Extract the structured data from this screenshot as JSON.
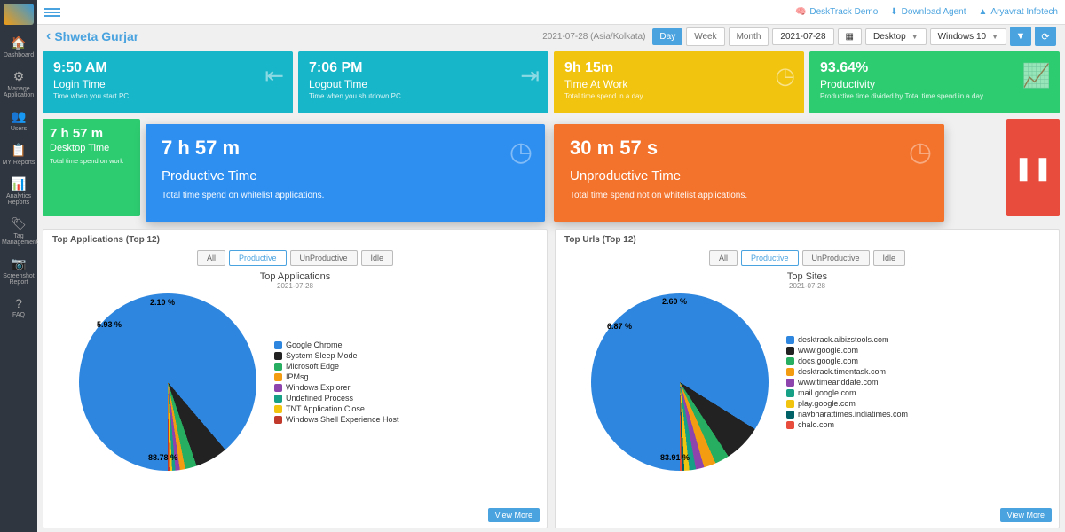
{
  "sidebar": {
    "items": [
      {
        "icon": "🏠",
        "label": "Dashboard"
      },
      {
        "icon": "⚙",
        "label": "Manage Application"
      },
      {
        "icon": "👥",
        "label": "Users"
      },
      {
        "icon": "📋",
        "label": "MY Reports"
      },
      {
        "icon": "📊",
        "label": "Analytics Reports"
      },
      {
        "icon": "🏷",
        "label": "Tag Management"
      },
      {
        "icon": "📷",
        "label": "Screenshot Report"
      },
      {
        "icon": "?",
        "label": "FAQ"
      }
    ]
  },
  "topbar": {
    "demo": "DeskTrack Demo",
    "download": "Download Agent",
    "company": "Aryavrat Infotech"
  },
  "breadcrumb": {
    "name": "Shweta Gurjar"
  },
  "toolbar": {
    "tz": "2021-07-28 (Asia/Kolkata)",
    "view_day": "Day",
    "view_week": "Week",
    "view_month": "Month",
    "date": "2021-07-28",
    "device": "Desktop",
    "os": "Windows 10"
  },
  "cards": {
    "login": {
      "value": "9:50 AM",
      "title": "Login Time",
      "sub": "Time when you start PC"
    },
    "logout": {
      "value": "7:06 PM",
      "title": "Logout Time",
      "sub": "Time when you shutdown PC"
    },
    "timeatwork": {
      "value": "9h 15m",
      "title": "Time At Work",
      "sub": "Total time spend in a day"
    },
    "productivity": {
      "value": "93.64%",
      "title": "Productivity",
      "sub": "Productive time divided by Total time spend in a day"
    },
    "desktop": {
      "value": "7 h 57 m",
      "title": "Desktop Time",
      "sub": "Total time spend on work"
    }
  },
  "floats": {
    "productive": {
      "value": "7 h 57 m",
      "title": "Productive Time",
      "desc": "Total time spend on whitelist applications."
    },
    "unproductive": {
      "value": "30 m 57 s",
      "title": "Unproductive Time",
      "desc": "Total time spend not on whitelist applications."
    }
  },
  "panel_apps": {
    "heading": "Top Applications (Top 12)",
    "filters": [
      "All",
      "Productive",
      "UnProductive",
      "Idle"
    ],
    "active_filter": "Productive",
    "chart_title": "Top Applications",
    "chart_date": "2021-07-28",
    "viewmore": "View More"
  },
  "panel_urls": {
    "heading": "Top Urls (Top 12)",
    "filters": [
      "All",
      "Productive",
      "UnProductive",
      "Idle"
    ],
    "active_filter": "Productive",
    "chart_title": "Top Sites",
    "chart_date": "2021-07-28",
    "viewmore": "View More"
  },
  "chart_data": [
    {
      "type": "pie",
      "title": "Top Applications",
      "date": "2021-07-28",
      "series": [
        {
          "name": "Google Chrome",
          "value": 88.78,
          "color": "#2e86de"
        },
        {
          "name": "System Sleep Mode",
          "value": 5.93,
          "color": "#222"
        },
        {
          "name": "Microsoft Edge",
          "value": 2.1,
          "color": "#27ae60"
        },
        {
          "name": "IPMsg",
          "value": 1.0,
          "color": "#f39c12"
        },
        {
          "name": "Windows Explorer",
          "value": 0.8,
          "color": "#8e44ad"
        },
        {
          "name": "Undefined Process",
          "value": 0.6,
          "color": "#16a085"
        },
        {
          "name": "TNT Application Close",
          "value": 0.5,
          "color": "#f1c40f"
        },
        {
          "name": "Windows Shell Experience Host",
          "value": 0.29,
          "color": "#c0392b"
        }
      ]
    },
    {
      "type": "pie",
      "title": "Top Sites",
      "date": "2021-07-28",
      "series": [
        {
          "name": "desktrack.aibizstools.com",
          "value": 83.91,
          "color": "#2e86de"
        },
        {
          "name": "www.google.com",
          "value": 6.87,
          "color": "#222"
        },
        {
          "name": "docs.google.com",
          "value": 2.6,
          "color": "#27ae60"
        },
        {
          "name": "desktrack.timentask.com",
          "value": 2.2,
          "color": "#f39c12"
        },
        {
          "name": "www.timeanddate.com",
          "value": 1.5,
          "color": "#8e44ad"
        },
        {
          "name": "mail.google.com",
          "value": 1.2,
          "color": "#16a085"
        },
        {
          "name": "play.google.com",
          "value": 0.9,
          "color": "#f1c40f"
        },
        {
          "name": "navbharattimes.indiatimes.com",
          "value": 0.5,
          "color": "#006266"
        },
        {
          "name": "chalo.com",
          "value": 0.32,
          "color": "#e74c3c"
        }
      ]
    }
  ]
}
